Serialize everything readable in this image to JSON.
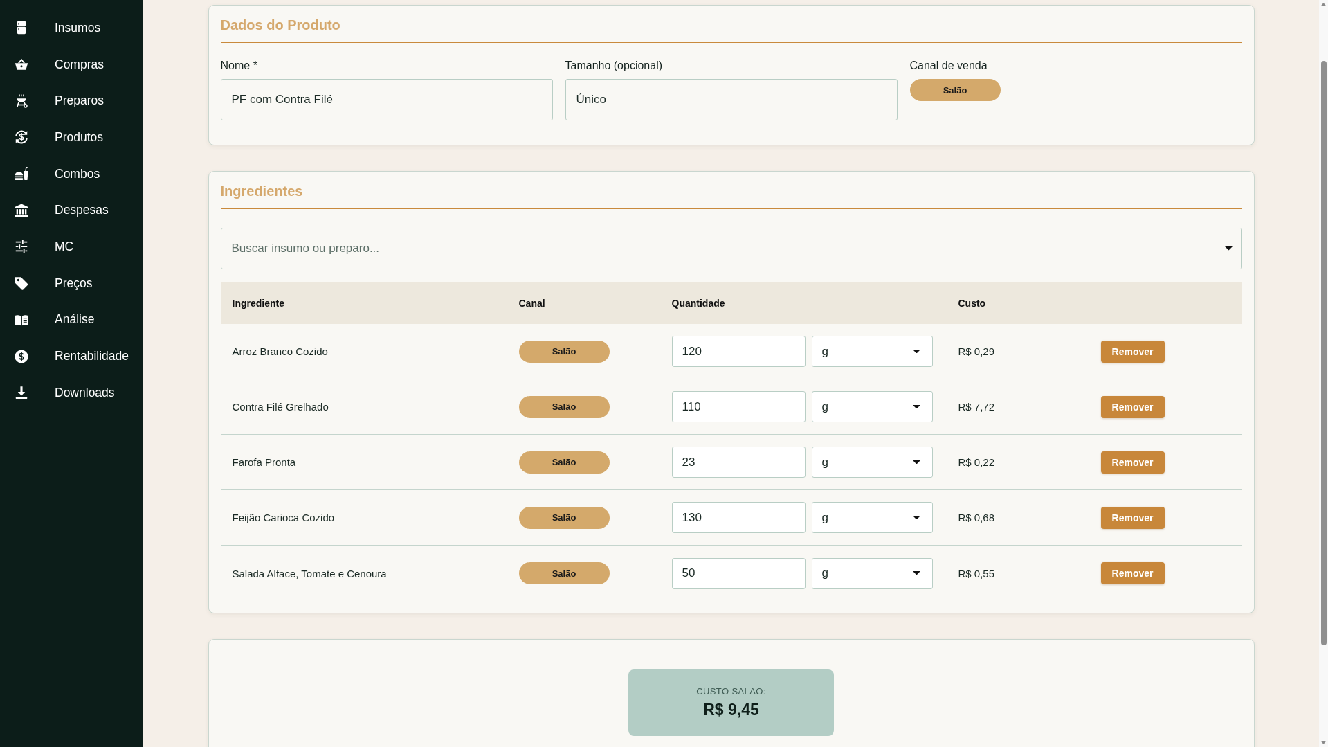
{
  "sidebar": {
    "items": [
      {
        "label": "Insumos"
      },
      {
        "label": "Compras"
      },
      {
        "label": "Preparos"
      },
      {
        "label": "Produtos"
      },
      {
        "label": "Combos"
      },
      {
        "label": "Despesas"
      },
      {
        "label": "MC"
      },
      {
        "label": "Preços"
      },
      {
        "label": "Análise"
      },
      {
        "label": "Rentabilidade"
      },
      {
        "label": "Downloads"
      }
    ]
  },
  "product": {
    "title": "Dados do Produto",
    "fields": [
      {
        "label": "Nome *",
        "value": "PF com Contra Filé"
      },
      {
        "label": "Tamanho (opcional)",
        "value": "Único"
      }
    ],
    "channel": {
      "label": "Canal de venda",
      "options": [
        {
          "label": "Salão",
          "selected": true
        }
      ]
    }
  },
  "ingredients": {
    "title": "Ingredientes",
    "search": {
      "placeholder": "Buscar insumo ou preparo..."
    },
    "table": {
      "columns": [
        "Ingrediente",
        "Canal",
        "Quantidade",
        "Custo"
      ],
      "rows": [
        {
          "ingredient": "Arroz Branco Cozido",
          "channel": "Salão",
          "quantity": "120",
          "unit": "g",
          "cost": "R$ 0,29",
          "action": "Remover"
        },
        {
          "ingredient": "Contra Filé Grelhado",
          "channel": "Salão",
          "quantity": "110",
          "unit": "g",
          "cost": "R$ 7,72",
          "action": "Remover"
        },
        {
          "ingredient": "Farofa Pronta",
          "channel": "Salão",
          "quantity": "23",
          "unit": "g",
          "cost": "R$ 0,22",
          "action": "Remover"
        },
        {
          "ingredient": "Feijão Carioca Cozido",
          "channel": "Salão",
          "quantity": "130",
          "unit": "g",
          "cost": "R$ 0,68",
          "action": "Remover"
        },
        {
          "ingredient": "Salada Alface, Tomate e Cenoura",
          "channel": "Salão",
          "quantity": "50",
          "unit": "g",
          "cost": "R$ 0,55",
          "action": "Remover"
        }
      ]
    }
  },
  "summary": {
    "label": "CUSTO SALÃO:",
    "value": "R$ 9,45"
  }
}
